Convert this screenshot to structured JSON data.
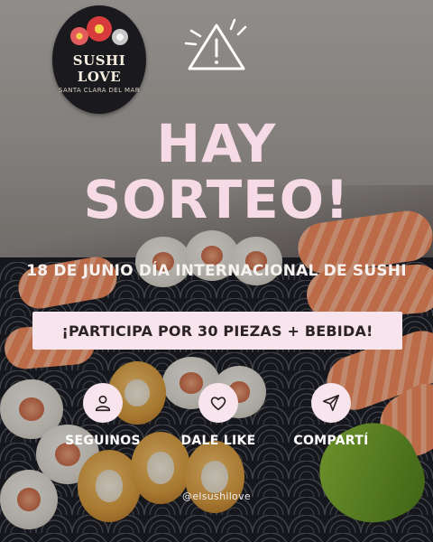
{
  "logo": {
    "brand": "SUSHI LOVE",
    "place": "SANTA CLARA DEL MAR"
  },
  "headline": {
    "line1": "HAY",
    "line2": "SORTEO!"
  },
  "subtitle": "18 DE JUNIO DÍA INTERNACIONAL DE SUSHI",
  "cta": "¡PARTICIPA POR 30 PIEZAS + BEBIDA!",
  "actions": [
    {
      "label": "SEGUINOS",
      "icon": "user-icon"
    },
    {
      "label": "DALE LIKE",
      "icon": "heart-icon"
    },
    {
      "label": "COMPARTÍ",
      "icon": "send-icon"
    }
  ],
  "handle": "@elsushilove",
  "colors": {
    "accent_pink": "#f6dbe6",
    "cta_background": "#f7e4ec",
    "text_dark": "#2b2326"
  }
}
